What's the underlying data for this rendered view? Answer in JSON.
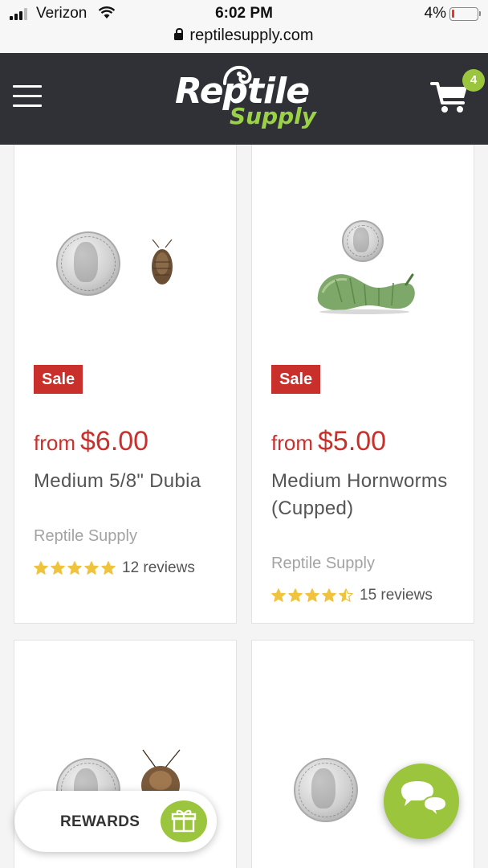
{
  "status_bar": {
    "carrier": "Verizon",
    "time": "6:02 PM",
    "battery": "4%",
    "url": "reptilesupply.com"
  },
  "header": {
    "logo_line1": "Reptile",
    "logo_line2": "Supply",
    "cart_count": "4",
    "accent_color": "#9bc53d",
    "bar_color": "#2f3136"
  },
  "products": [
    {
      "badge": "Sale",
      "price_prefix": "from",
      "price": "$6.00",
      "title": "Medium 5/8\" Dubia",
      "vendor": "Reptile Supply",
      "rating": 5,
      "reviews": "12 reviews"
    },
    {
      "badge": "Sale",
      "price_prefix": "from",
      "price": "$5.00",
      "title": "Medium Hornworms (Cupped)",
      "vendor": "Reptile Supply",
      "rating": 4.5,
      "reviews": "15 reviews"
    }
  ],
  "rewards": {
    "label": "REWARDS"
  },
  "icons": {
    "menu": "hamburger-menu-icon",
    "cart": "shopping-cart-icon",
    "gift": "gift-icon",
    "chat": "chat-bubbles-icon",
    "lock": "lock-icon"
  },
  "colors": {
    "sale": "#c9302c",
    "star": "#f0c33c"
  }
}
